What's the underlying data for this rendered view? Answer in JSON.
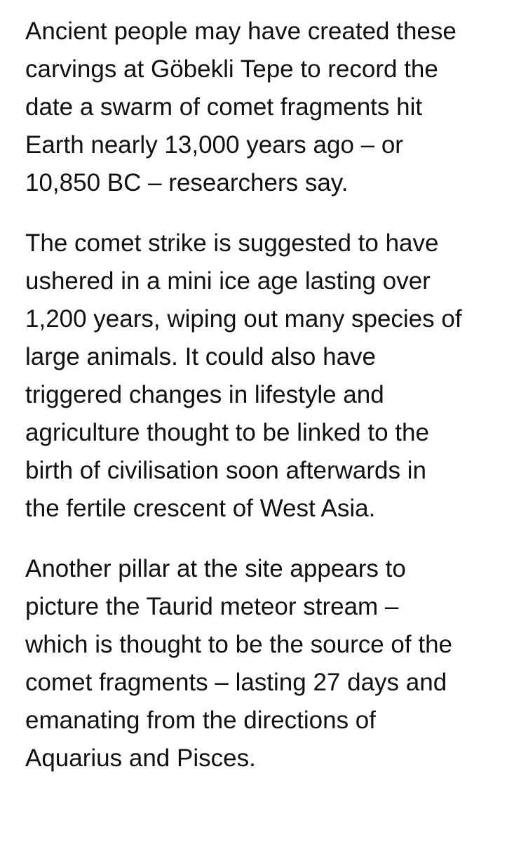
{
  "article": {
    "paragraphs": [
      {
        "lines": [
          "Ancient people may have created these",
          "carvings at Göbekli Tepe to record the",
          "date a swarm of comet fragments hit",
          "Earth nearly 13,000 years ago – or",
          "10,850 BC – researchers say."
        ]
      },
      {
        "lines": [
          "The comet strike is suggested to have",
          "ushered in a mini ice age lasting over",
          "1,200 years, wiping out many species of",
          "large animals. It could also have",
          "triggered changes in lifestyle and",
          "agriculture thought to be linked to the",
          "birth of civilisation soon afterwards in",
          "the fertile crescent of West Asia."
        ]
      },
      {
        "lines": [
          "Another pillar at the site appears to",
          "picture the Taurid meteor stream –",
          "which is thought to be the source of the",
          "comet fragments – lasting 27 days and",
          "emanating from the directions of",
          "Aquarius and Pisces."
        ]
      }
    ]
  }
}
